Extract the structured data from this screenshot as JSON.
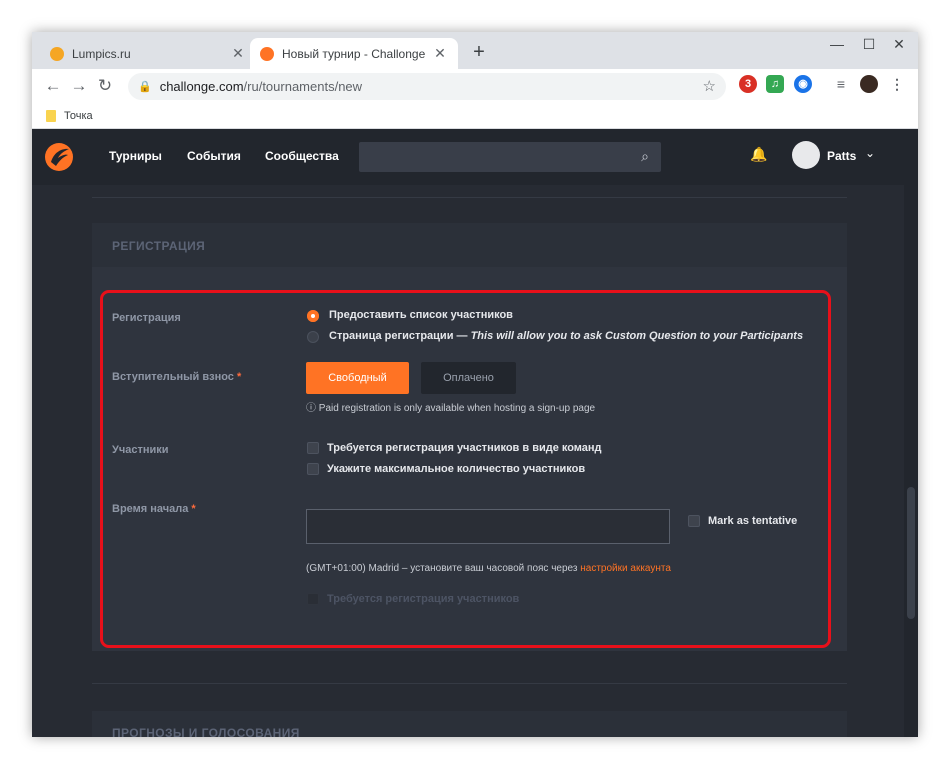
{
  "browser": {
    "tabs": [
      {
        "title": "Lumpics.ru",
        "favicon_color": "#f5a623"
      },
      {
        "title": "Новый турнир - Challonge",
        "favicon_color": "#ff7324"
      }
    ],
    "new_tab": "+",
    "window_controls": {
      "minimize": "—",
      "maximize": "☐",
      "close": "✕"
    },
    "url_host": "challonge.com",
    "url_path": "/ru/tournaments/new",
    "extensions": [
      {
        "name": "opera-icon",
        "badge": "3",
        "color": "#d93025"
      },
      {
        "name": "music-icon",
        "color": "#34a853"
      },
      {
        "name": "vpn-icon",
        "color": "#1a73e8"
      }
    ],
    "bookmarks": [
      {
        "label": "Точка"
      }
    ]
  },
  "site": {
    "nav": [
      "Турниры",
      "События",
      "Сообщества"
    ],
    "username": "Patts",
    "accent": "#ff7324"
  },
  "registration_section": {
    "title": "РЕГИСТРАЦИЯ",
    "registration_label": "Регистрация",
    "option_list": "Предоставить список участников",
    "option_page": "Страница регистрации — ",
    "option_page_note": "This will allow you to ask Custom Question to your Participants",
    "fee_label": "Вступительный взнос",
    "required_mark": "*",
    "fee_free": "Свободный",
    "fee_paid": "Оплачено",
    "paid_note": "Paid registration is only available when hosting a sign-up page",
    "participants_label": "Участники",
    "team_registration": "Требуется регистрация участников в виде команд",
    "max_participants": "Укажите максимальное количество участников",
    "start_time_label": "Время начала",
    "start_time_value": "",
    "tentative_label": "Mark as tentative",
    "timezone_text": "(GMT+01:00) Madrid – установите ваш часовой пояс через ",
    "timezone_link": "настройки аккаунта",
    "require_registration": "Требуется регистрация участников"
  },
  "next_section": {
    "title": "ПРОГНОЗЫ И ГОЛОСОВАНИЯ"
  }
}
